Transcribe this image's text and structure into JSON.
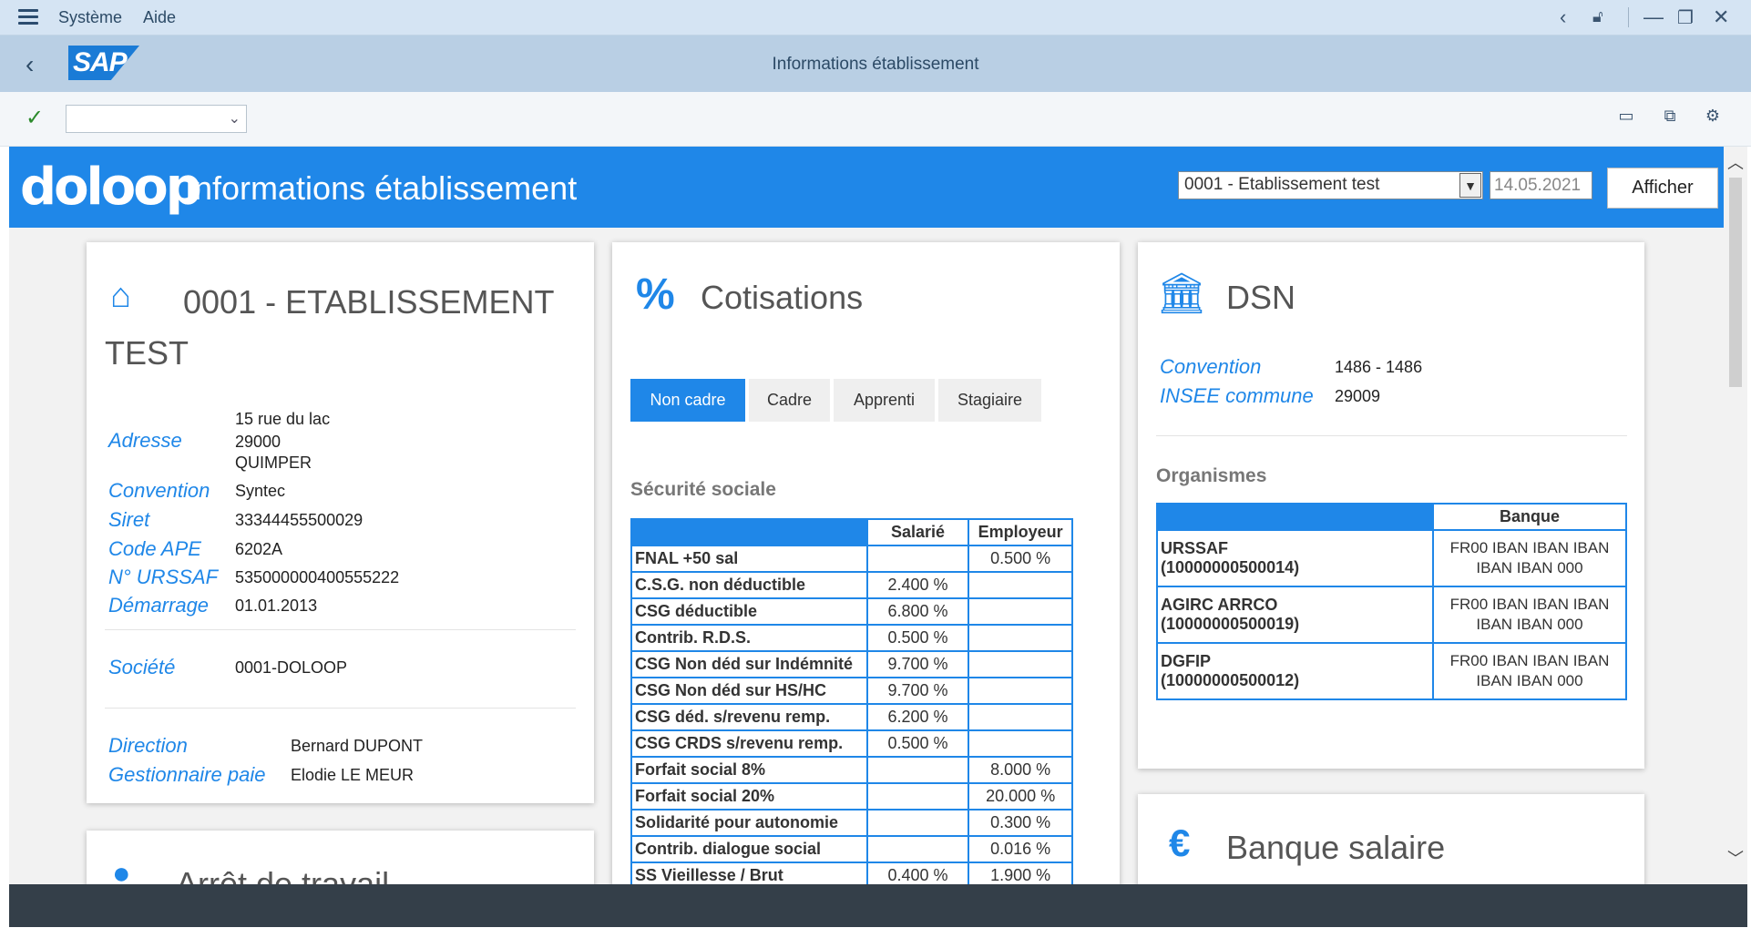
{
  "menu": {
    "items": [
      "Système",
      "Aide"
    ]
  },
  "titlebar": {
    "title": "Informations établissement",
    "logo": "SAP"
  },
  "banner": {
    "logo": "doloop",
    "title": "Informations établissement",
    "etablissement": "0001 - Etablissement test",
    "date": "14.05.2021",
    "button": "Afficher"
  },
  "etab_card": {
    "title": "0001 - ETABLISSEMENT TEST",
    "adresse_label": "Adresse",
    "adresse_lines": [
      "15 rue du lac",
      "29000",
      "QUIMPER"
    ],
    "fields": [
      {
        "label": "Convention",
        "value": "Syntec"
      },
      {
        "label": "Siret",
        "value": "33344455500029"
      },
      {
        "label": "Code APE",
        "value": "6202A"
      },
      {
        "label": "N° URSSAF",
        "value": "535000000400555222"
      },
      {
        "label": "Démarrage",
        "value": "01.01.2013"
      }
    ],
    "societe_label": "Société",
    "societe_value": "0001-DOLOOP",
    "people": [
      {
        "label": "Direction",
        "value": "Bernard DUPONT"
      },
      {
        "label": "Gestionnaire paie",
        "value": "Elodie LE MEUR"
      }
    ]
  },
  "arret_card": {
    "title": "Arrêt de travail"
  },
  "cotisations": {
    "title": "Cotisations",
    "tabs": [
      "Non cadre",
      "Cadre",
      "Apprenti",
      "Stagiaire"
    ],
    "active_tab": 0,
    "section": "Sécurité sociale",
    "headers": [
      "",
      "Salarié",
      "Employeur"
    ],
    "rows": [
      [
        "FNAL +50 sal",
        "",
        "0.500 %"
      ],
      [
        "C.S.G. non déductible",
        "2.400 %",
        ""
      ],
      [
        "CSG déductible",
        "6.800 %",
        ""
      ],
      [
        "Contrib. R.D.S.",
        "0.500 %",
        ""
      ],
      [
        "CSG Non déd sur Indémnité",
        "9.700 %",
        ""
      ],
      [
        "CSG Non déd sur HS/HC",
        "9.700 %",
        ""
      ],
      [
        "CSG déd. s/revenu remp.",
        "6.200 %",
        ""
      ],
      [
        "CSG CRDS s/revenu remp.",
        "0.500 %",
        ""
      ],
      [
        "Forfait social 8%",
        "",
        "8.000 %"
      ],
      [
        "Forfait social 20%",
        "",
        "20.000 %"
      ],
      [
        "Solidarité pour autonomie",
        "",
        "0.300 %"
      ],
      [
        "Contrib. dialogue social",
        "",
        "0.016 %"
      ],
      [
        "SS Vieillesse / Brut",
        "0.400 %",
        "1.900 %"
      ]
    ]
  },
  "dsn": {
    "title": "DSN",
    "fields": [
      {
        "label": "Convention",
        "value": "1486 - 1486"
      },
      {
        "label": "INSEE commune",
        "value": "29009"
      }
    ],
    "organismes_title": "Organismes",
    "headers": [
      "",
      "Banque"
    ],
    "rows": [
      {
        "org": "URSSAF",
        "id": "(10000000500014)",
        "banque": "FR00 IBAN IBAN IBAN IBAN IBAN 000"
      },
      {
        "org": "AGIRC ARRCO",
        "id": "(10000000500019)",
        "banque": "FR00 IBAN IBAN IBAN IBAN IBAN 000"
      },
      {
        "org": "DGFIP",
        "id": "(10000000500012)",
        "banque": "FR00 IBAN IBAN IBAN IBAN IBAN 000"
      }
    ]
  },
  "banque_card": {
    "title": "Banque salaire"
  },
  "colors": {
    "accent": "#1f87e8",
    "menubar": "#d5e4f3",
    "titlebar": "#b9cfe4",
    "status": "#343f49"
  }
}
